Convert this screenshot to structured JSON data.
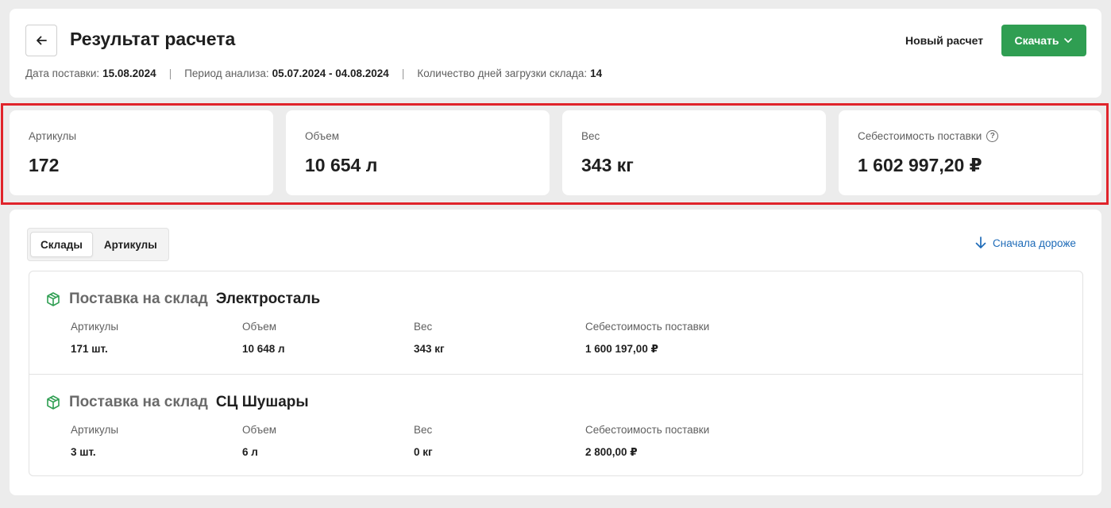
{
  "header": {
    "title": "Результат расчета",
    "new_calc_label": "Новый расчет",
    "download_label": "Скачать",
    "meta": [
      {
        "label": "Дата поставки:",
        "value": "15.08.2024"
      },
      {
        "label": "Период анализа:",
        "value": "05.07.2024 - 04.08.2024"
      },
      {
        "label": "Количество дней загрузки склада:",
        "value": "14"
      }
    ],
    "separator": "|"
  },
  "stats": [
    {
      "label": "Артикулы",
      "value": "172"
    },
    {
      "label": "Объем",
      "value": "10 654 л"
    },
    {
      "label": "Вес",
      "value": "343 кг"
    },
    {
      "label": "Себестоимость поставки",
      "value": "1 602 997,20 ₽",
      "help_icon": "?"
    }
  ],
  "tabs": [
    {
      "label": "Склады",
      "active": true
    },
    {
      "label": "Артикулы",
      "active": false
    }
  ],
  "sort": {
    "label": "Сначала дороже",
    "icon": "arrow-down-icon"
  },
  "warehouses": [
    {
      "prefix": "Поставка на склад",
      "name": "Электросталь",
      "columns": [
        {
          "label": "Артикулы",
          "value": "171 шт."
        },
        {
          "label": "Объем",
          "value": "10 648 л"
        },
        {
          "label": "Вес",
          "value": "343 кг"
        },
        {
          "label": "Себестоимость поставки",
          "value": "1 600 197,00 ₽"
        }
      ]
    },
    {
      "prefix": "Поставка на склад",
      "name": "СЦ Шушары",
      "columns": [
        {
          "label": "Артикулы",
          "value": "3 шт."
        },
        {
          "label": "Объем",
          "value": "6 л"
        },
        {
          "label": "Вес",
          "value": "0 кг"
        },
        {
          "label": "Себестоимость поставки",
          "value": "2 800,00 ₽"
        }
      ]
    }
  ],
  "colors": {
    "accent_green": "#2f9e52",
    "link_blue": "#1e6bb8",
    "highlight_red": "#e0242b"
  }
}
